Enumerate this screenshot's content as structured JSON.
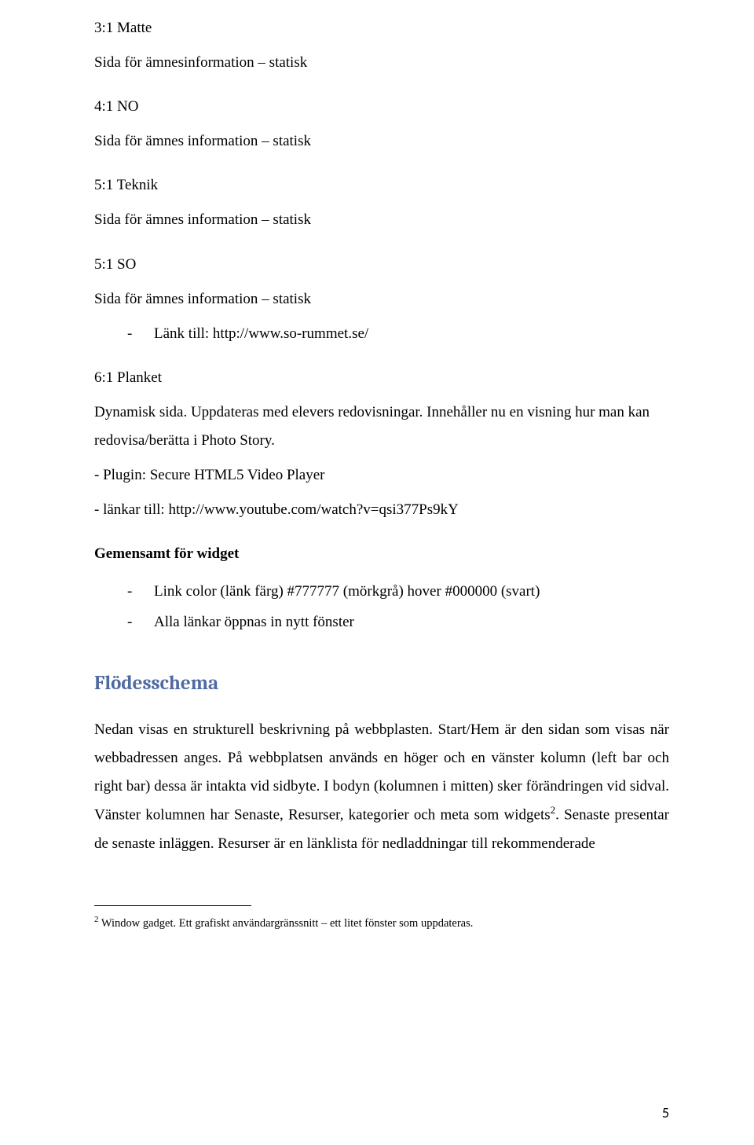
{
  "sec_matte": {
    "heading": "3:1 Matte",
    "line": "Sida för ämnesinformation – statisk"
  },
  "sec_no": {
    "heading": "4:1 NO",
    "line": "Sida för ämnes information – statisk"
  },
  "sec_teknik": {
    "heading": "5:1 Teknik",
    "line": "Sida för ämnes information – statisk"
  },
  "sec_so": {
    "heading": "5:1 SO",
    "line": "Sida för ämnes information – statisk",
    "link": "Länk till: http://www.so-rummet.se/"
  },
  "sec_planket": {
    "heading": "6:1 Planket",
    "line1": "Dynamisk sida. Uppdateras med elevers redovisningar. Innehåller nu en visning hur man kan redovisa/berätta i Photo Story.",
    "line2": "- Plugin: Secure HTML5 Video Player",
    "line3": "- länkar till: http://www.youtube.com/watch?v=qsi377Ps9kY"
  },
  "widget": {
    "heading": "Gemensamt för widget",
    "items": [
      "Link color (länk färg) #777777 (mörkgrå) hover #000000 (svart)",
      "Alla länkar öppnas in nytt fönster"
    ]
  },
  "flow": {
    "heading": "Flödesschema",
    "body_pre": "Nedan visas en strukturell beskrivning på webbplasten. Start/Hem är den sidan som visas när webbadressen anges. På webbplatsen används en höger och en vänster kolumn (left bar och right bar) dessa är intakta vid sidbyte.  I bodyn (kolumnen i mitten) sker förändringen vid sidval.  Vänster kolumnen har Senaste, Resurser, kategorier och meta som widgets",
    "super": "2",
    "body_post": ". Senaste presentar de senaste inläggen. Resurser är en länklista för nedladdningar till rekommenderade"
  },
  "footnote": {
    "num": "2",
    "text": " Window gadget. Ett grafiskt användargränssnitt – ett litet fönster som uppdateras."
  },
  "page_number": "5"
}
